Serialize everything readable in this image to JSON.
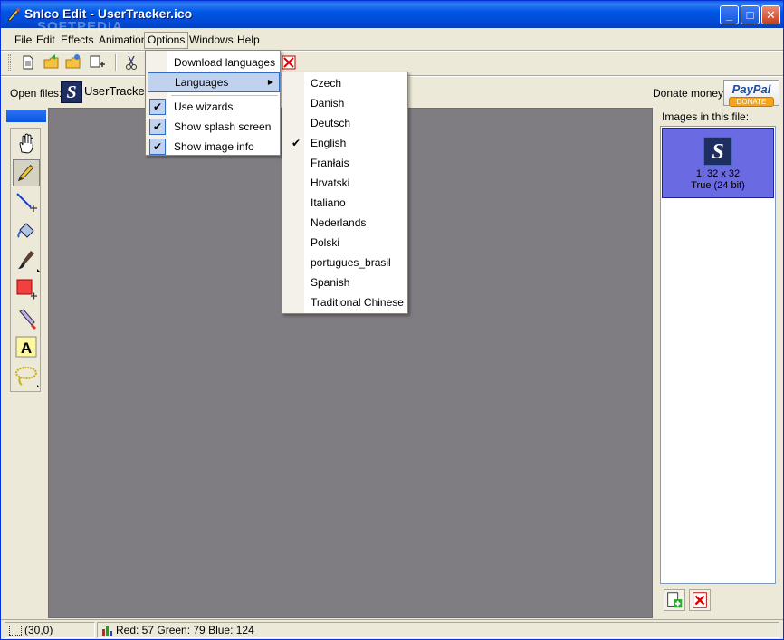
{
  "window": {
    "title": "SnIco Edit - UserTracker.ico",
    "minimize_label": "_",
    "maximize_label": "□",
    "close_label": "✕",
    "watermark": "SOFTPEDIA"
  },
  "menubar": {
    "items": [
      "File",
      "Edit",
      "Effects",
      "Animation",
      "Options",
      "Windows",
      "Help"
    ],
    "open_item": "Options"
  },
  "open_files": {
    "label": "Open files:",
    "file_name": "UserTracker.ico",
    "thumb_letter": "S"
  },
  "donate": {
    "label": "Donate money:",
    "paypal": "PayPal",
    "donate_text": "DONATE"
  },
  "options_menu": {
    "items": [
      {
        "label": "Download languages",
        "checked": false,
        "submenu": false
      },
      {
        "label": "Languages",
        "checked": false,
        "submenu": true,
        "highlighted": true
      },
      {
        "label": "Use wizards",
        "checked": true
      },
      {
        "label": "Show splash screen",
        "checked": true
      },
      {
        "label": "Show image info",
        "checked": true
      }
    ],
    "check_glyph": "✔",
    "arrow_glyph": "▶"
  },
  "languages_menu": {
    "items": [
      "Czech",
      "Danish",
      "Deutsch",
      "English",
      "Franłais",
      "Hrvatski",
      "Italiano",
      "Nederlands",
      "Polski",
      "portugues_brasil",
      "Spanish",
      "Traditional Chinese"
    ],
    "selected": "English"
  },
  "images_panel": {
    "title": "Images in this file:",
    "items": [
      {
        "thumb_letter": "S",
        "size": "1: 32 x 32",
        "depth": "True (24 bit)"
      }
    ]
  },
  "statusbar": {
    "position": "(30,0)",
    "color": "Red: 57 Green: 79 Blue: 124"
  },
  "tools": [
    "hand-icon",
    "pencil-icon",
    "line-icon",
    "fill-bucket-icon",
    "brush-icon",
    "rectangle-icon",
    "color-picker-icon",
    "text-icon",
    "lasso-icon"
  ],
  "colors": {
    "title_blue": "#0055E5",
    "canvas_gray": "#807D82",
    "menu_highlight": "#C1D2EE",
    "image_item_bg": "#6A6AE2"
  }
}
